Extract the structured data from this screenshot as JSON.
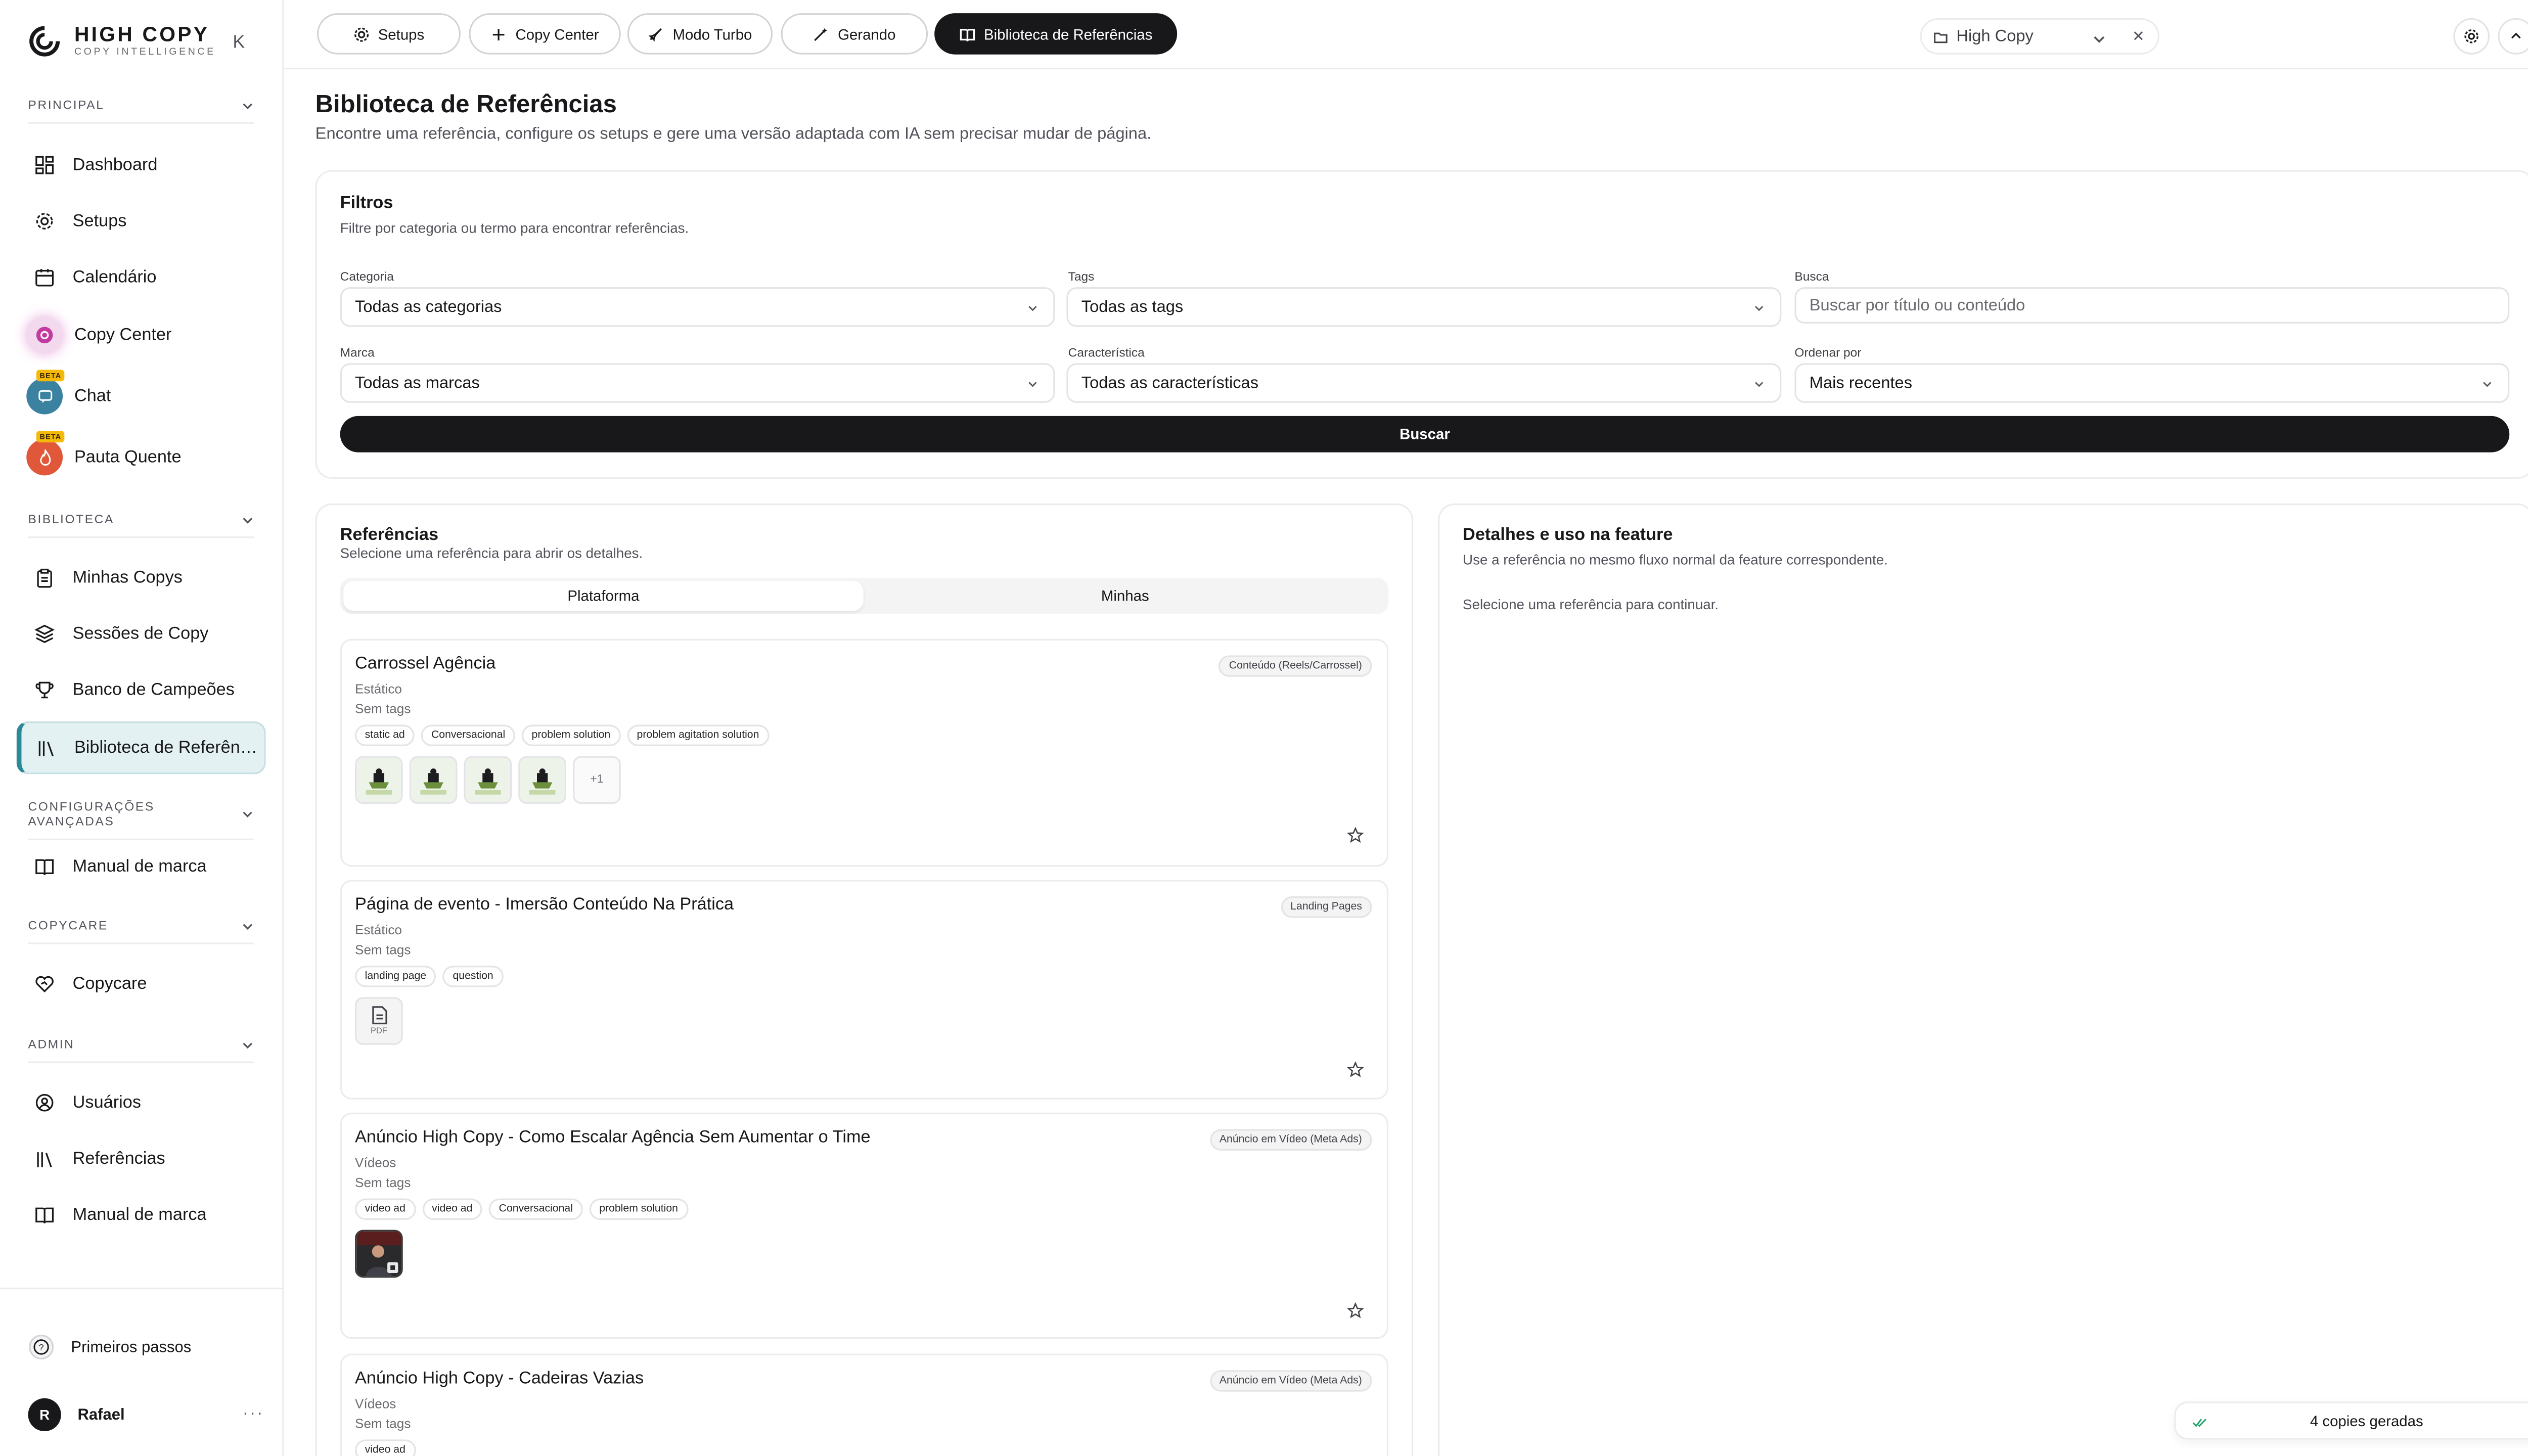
{
  "app": {
    "brand_title": "HIGH COPY",
    "brand_subtitle": "COPY INTELLIGENCE",
    "collapse_glyph": "K"
  },
  "sidebar": {
    "sections": {
      "principal": "PRINCIPAL",
      "biblioteca": "BIBLIOTECA",
      "config": "CONFIGURAÇÕES AVANÇADAS",
      "copycare": "COPYCARE",
      "admin": "ADMIN"
    },
    "items": {
      "dashboard": "Dashboard",
      "setups": "Setups",
      "calendario": "Calendário",
      "copy_center": "Copy Center",
      "chat": "Chat",
      "pauta_quente": "Pauta Quente",
      "minhas_copys": "Minhas Copys",
      "sessoes": "Sessões de Copy",
      "banco": "Banco de Campeões",
      "biblioteca_ref": "Biblioteca de Referências",
      "manual_marca": "Manual de marca",
      "copycare": "Copycare",
      "usuarios": "Usuários",
      "referencias": "Referências",
      "manual_marca_admin": "Manual de marca"
    },
    "beta_label": "BETA",
    "footer": {
      "primeiros_passos": "Primeiros passos",
      "user_initial": "R",
      "user_name": "Rafael",
      "more": "···"
    }
  },
  "topbar": {
    "tabs": [
      "Setups",
      "Copy Center",
      "Modo Turbo",
      "Gerando",
      "Biblioteca de Referências"
    ],
    "active_tab": "Biblioteca de Referências",
    "brand_select": "High Copy",
    "clear_glyph": "✕"
  },
  "page": {
    "title": "Biblioteca de Referências",
    "subtitle": "Encontre uma referência, configure os setups e gere uma versão adaptada com IA sem precisar mudar de página."
  },
  "filters": {
    "title": "Filtros",
    "subtitle": "Filtre por categoria ou termo para encontrar referências.",
    "categoria_label": "Categoria",
    "categoria_value": "Todas as categorias",
    "tags_label": "Tags",
    "tags_value": "Todas as tags",
    "busca_label": "Busca",
    "busca_placeholder": "Buscar por título ou conteúdo",
    "marca_label": "Marca",
    "marca_value": "Todas as marcas",
    "caracteristica_label": "Característica",
    "caracteristica_value": "Todas as características",
    "ordenar_label": "Ordenar por",
    "ordenar_value": "Mais recentes",
    "buscar_button": "Buscar"
  },
  "referencias": {
    "title": "Referências",
    "subtitle": "Selecione uma referência para abrir os detalhes.",
    "segment": [
      "Plataforma",
      "Minhas"
    ],
    "active_segment": "Plataforma",
    "items": [
      {
        "title": "Carrossel Agência",
        "category": "Conteúdo (Reels/Carrossel)",
        "type": "Estático",
        "tags_text": "Sem tags",
        "chips": [
          "static ad",
          "Conversacional",
          "problem solution",
          "problem agitation solution"
        ],
        "more_count": "+1"
      },
      {
        "title": "Página de evento - Imersão Conteúdo Na Prática",
        "category": "Landing Pages",
        "type": "Estático",
        "tags_text": "Sem tags",
        "chips": [
          "landing page",
          "question"
        ],
        "file_label": "PDF"
      },
      {
        "title": "Anúncio High Copy - Como Escalar Agência Sem Aumentar o Time",
        "category": "Anúncio em Vídeo (Meta Ads)",
        "type": "Vídeos",
        "tags_text": "Sem tags",
        "chips": [
          "video ad",
          "video ad",
          "Conversacional",
          "problem solution"
        ]
      },
      {
        "title": "Anúncio High Copy - Cadeiras Vazias",
        "category": "Anúncio em Vídeo (Meta Ads)",
        "type": "Vídeos",
        "tags_text": "Sem tags",
        "chips": [
          "video ad"
        ]
      }
    ]
  },
  "details": {
    "title": "Detalhes e uso na feature",
    "subtitle": "Use a referência no mesmo fluxo normal da feature correspondente.",
    "empty": "Selecione uma referência para continuar."
  },
  "toast": {
    "text": "4 copies geradas"
  },
  "colors": {
    "accent_teal": "#2b8a99",
    "dark": "#18181b",
    "beta": "#f5b90a",
    "copy_center": "#c33ba0",
    "chat": "#3b82a0",
    "pauta": "#e0573a",
    "float_purple": "#6d3fd8"
  }
}
